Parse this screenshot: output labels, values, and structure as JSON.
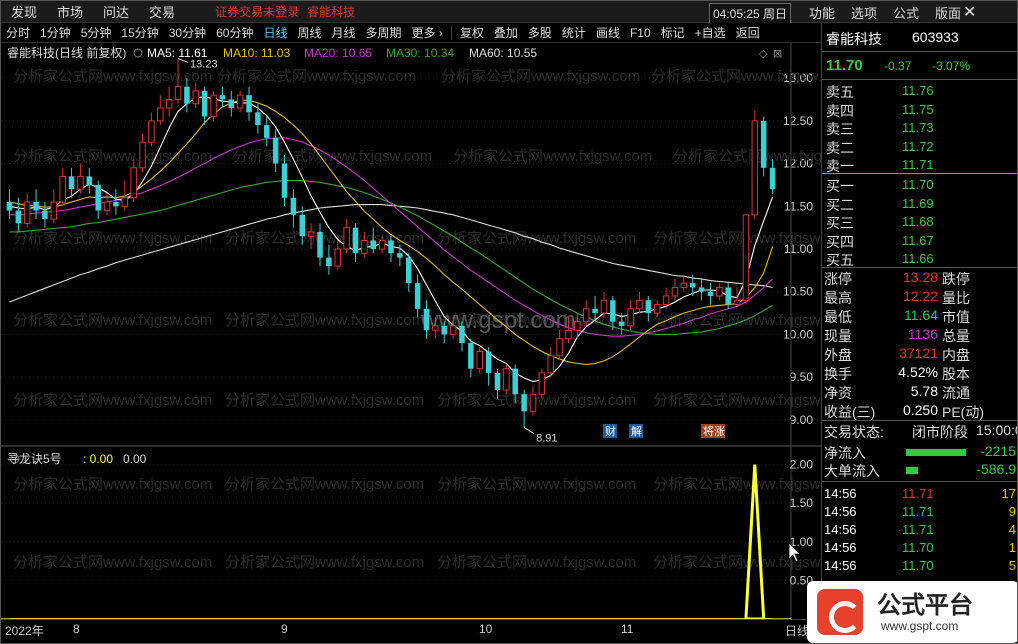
{
  "menubar": {
    "items": [
      "发现",
      "市场",
      "问达",
      "交易"
    ],
    "warning": "证券交易未登录",
    "stock_name": "睿能科技",
    "clock": "04:05:25 周日",
    "right_items": [
      "功能",
      "选项",
      "公式",
      "版面"
    ],
    "close": "✕"
  },
  "toolbar": {
    "periods": [
      "分时",
      "1分钟",
      "5分钟",
      "15分钟",
      "30分钟",
      "60分钟",
      "日线",
      "周线",
      "月线",
      "多周期",
      "更多 ›"
    ],
    "active_period": "日线",
    "actions": [
      "复权",
      "叠加",
      "多股",
      "统计",
      "画线",
      "F10",
      "标记",
      "+自选",
      "返回"
    ]
  },
  "chart_header": {
    "title": "睿能科技(日线 前复权)",
    "ma5": "MA5: 11.61",
    "ma10": "MA10: 11.03",
    "ma20": "MA20: 10.65",
    "ma30": "MA30: 10.34",
    "ma60": "MA60: 10.55"
  },
  "colors": {
    "up": "#e03030",
    "down": "#39d0d8",
    "ma5": "#ffffff",
    "ma10": "#e6c200",
    "ma20": "#cc33cc",
    "ma30": "#33aa33",
    "ma60": "#dddddd",
    "grid": "#5a0a0a",
    "indicator": "#ffff33"
  },
  "chart_data": [
    {
      "type": "candlestick",
      "title": "睿能科技(日线 前复权)",
      "yticks": [
        9.0,
        9.5,
        10.0,
        10.5,
        11.0,
        11.5,
        12.0,
        12.5,
        13.0
      ],
      "ylim": [
        8.8,
        13.2
      ],
      "high_label": "13.23",
      "low_label": "8.91",
      "annotations": [
        "财",
        "解",
        "将涨"
      ],
      "candles": [
        [
          11.55,
          11.45,
          11.7,
          11.35
        ],
        [
          11.45,
          11.3,
          11.6,
          11.2
        ],
        [
          11.3,
          11.55,
          11.65,
          11.25
        ],
        [
          11.55,
          11.45,
          11.7,
          11.35
        ],
        [
          11.45,
          11.35,
          11.55,
          11.25
        ],
        [
          11.35,
          11.55,
          11.7,
          11.3
        ],
        [
          11.55,
          11.85,
          11.95,
          11.5
        ],
        [
          11.85,
          11.7,
          11.95,
          11.6
        ],
        [
          11.7,
          11.85,
          12.0,
          11.65
        ],
        [
          11.85,
          11.75,
          11.95,
          11.65
        ],
        [
          11.75,
          11.45,
          11.8,
          11.35
        ],
        [
          11.45,
          11.55,
          11.65,
          11.4
        ],
        [
          11.55,
          11.5,
          11.7,
          11.4
        ],
        [
          11.5,
          11.6,
          11.8,
          11.45
        ],
        [
          11.6,
          11.95,
          12.05,
          11.55
        ],
        [
          11.95,
          12.25,
          12.35,
          11.9
        ],
        [
          12.25,
          12.5,
          12.6,
          12.2
        ],
        [
          12.5,
          12.65,
          12.8,
          12.45
        ],
        [
          12.65,
          12.75,
          12.9,
          12.55
        ],
        [
          12.75,
          12.9,
          13.23,
          12.7
        ],
        [
          12.9,
          12.7,
          13.0,
          12.6
        ],
        [
          12.7,
          12.85,
          12.95,
          12.65
        ],
        [
          12.85,
          12.55,
          12.9,
          12.45
        ],
        [
          12.55,
          12.8,
          12.85,
          12.5
        ],
        [
          12.8,
          12.75,
          12.9,
          12.65
        ],
        [
          12.75,
          12.65,
          12.85,
          12.55
        ],
        [
          12.65,
          12.8,
          12.85,
          12.6
        ],
        [
          12.8,
          12.6,
          12.9,
          12.5
        ],
        [
          12.6,
          12.45,
          12.7,
          12.35
        ],
        [
          12.45,
          12.3,
          12.55,
          12.2
        ],
        [
          12.3,
          12.0,
          12.4,
          11.9
        ],
        [
          12.0,
          11.6,
          12.1,
          11.5
        ],
        [
          11.6,
          11.4,
          11.7,
          11.25
        ],
        [
          11.4,
          11.15,
          11.5,
          11.05
        ],
        [
          11.15,
          11.2,
          11.3,
          11.0
        ],
        [
          11.2,
          10.9,
          11.3,
          10.8
        ],
        [
          10.9,
          10.8,
          11.05,
          10.7
        ],
        [
          10.8,
          11.0,
          11.1,
          10.75
        ],
        [
          11.0,
          11.25,
          11.35,
          10.95
        ],
        [
          11.25,
          10.95,
          11.3,
          10.85
        ],
        [
          10.95,
          11.1,
          11.2,
          10.9
        ],
        [
          11.1,
          11.0,
          11.25,
          10.95
        ],
        [
          11.0,
          11.1,
          11.15,
          10.95
        ],
        [
          11.1,
          10.95,
          11.15,
          10.85
        ],
        [
          10.95,
          10.9,
          11.05,
          10.8
        ],
        [
          10.9,
          10.6,
          10.95,
          10.5
        ],
        [
          10.6,
          10.3,
          10.7,
          10.2
        ],
        [
          10.3,
          10.05,
          10.4,
          9.95
        ],
        [
          10.05,
          10.1,
          10.2,
          9.95
        ],
        [
          10.1,
          10.0,
          10.15,
          9.9
        ],
        [
          10.0,
          10.1,
          10.2,
          9.95
        ],
        [
          10.1,
          9.9,
          10.15,
          9.8
        ],
        [
          9.9,
          9.6,
          9.95,
          9.5
        ],
        [
          9.6,
          9.8,
          9.85,
          9.55
        ],
        [
          9.8,
          9.55,
          9.85,
          9.4
        ],
        [
          9.55,
          9.35,
          9.6,
          9.25
        ],
        [
          9.35,
          9.6,
          9.65,
          9.3
        ],
        [
          9.6,
          9.3,
          9.65,
          9.2
        ],
        [
          9.3,
          9.1,
          9.35,
          8.91
        ],
        [
          9.1,
          9.3,
          9.4,
          9.05
        ],
        [
          9.3,
          9.55,
          9.6,
          9.25
        ],
        [
          9.55,
          9.75,
          9.85,
          9.5
        ],
        [
          9.75,
          9.95,
          10.05,
          9.7
        ],
        [
          9.95,
          10.05,
          10.2,
          9.9
        ],
        [
          10.05,
          10.15,
          10.25,
          9.95
        ],
        [
          10.15,
          10.3,
          10.4,
          10.1
        ],
        [
          10.3,
          10.25,
          10.45,
          10.15
        ],
        [
          10.25,
          10.4,
          10.5,
          10.2
        ],
        [
          10.4,
          10.15,
          10.45,
          10.05
        ],
        [
          10.15,
          10.1,
          10.25,
          10.0
        ],
        [
          10.1,
          10.3,
          10.4,
          10.05
        ],
        [
          10.3,
          10.4,
          10.5,
          10.25
        ],
        [
          10.4,
          10.25,
          10.45,
          10.15
        ],
        [
          10.25,
          10.35,
          10.4,
          10.2
        ],
        [
          10.35,
          10.45,
          10.55,
          10.3
        ],
        [
          10.45,
          10.55,
          10.65,
          10.4
        ],
        [
          10.55,
          10.6,
          10.7,
          10.5
        ],
        [
          10.6,
          10.55,
          10.7,
          10.45
        ],
        [
          10.55,
          10.5,
          10.65,
          10.4
        ],
        [
          10.5,
          10.45,
          10.6,
          10.35
        ],
        [
          10.45,
          10.55,
          10.6,
          10.4
        ],
        [
          10.55,
          10.35,
          10.6,
          10.3
        ],
        [
          10.35,
          10.4,
          10.55,
          10.35
        ],
        [
          10.4,
          11.4,
          11.4,
          10.35
        ],
        [
          11.4,
          12.5,
          12.62,
          11.35
        ],
        [
          12.5,
          11.95,
          12.55,
          11.85
        ],
        [
          11.95,
          11.7,
          12.05,
          11.64
        ]
      ],
      "ma5": [
        11.5,
        11.48,
        11.47,
        11.49,
        11.46,
        11.49,
        11.57,
        11.62,
        11.7,
        11.76,
        11.72,
        11.66,
        11.58,
        11.57,
        11.64,
        11.79,
        11.97,
        12.19,
        12.42,
        12.61,
        12.7,
        12.77,
        12.78,
        12.76,
        12.73,
        12.72,
        12.71,
        12.71,
        12.65,
        12.56,
        12.43,
        12.25,
        12.05,
        11.84,
        11.62,
        11.43,
        11.25,
        11.11,
        11.03,
        10.98,
        11.02,
        11.03,
        11.07,
        11.03,
        11.01,
        10.92,
        10.77,
        10.58,
        10.39,
        10.21,
        10.11,
        10.04,
        9.92,
        9.87,
        9.79,
        9.71,
        9.66,
        9.55,
        9.49,
        9.45,
        9.47,
        9.52,
        9.63,
        9.78,
        9.97,
        10.09,
        10.17,
        10.25,
        10.24,
        10.21,
        10.23,
        10.26,
        10.27,
        10.3,
        10.33,
        10.38,
        10.44,
        10.48,
        10.52,
        10.52,
        10.51,
        10.45,
        10.43,
        10.64,
        11.04,
        11.33,
        11.61
      ],
      "ma10": [
        11.55,
        11.53,
        11.51,
        11.5,
        11.49,
        11.49,
        11.52,
        11.55,
        11.58,
        11.61,
        11.6,
        11.61,
        11.6,
        11.62,
        11.67,
        11.74,
        11.82,
        11.91,
        12.01,
        12.12,
        12.23,
        12.35,
        12.48,
        12.58,
        12.66,
        12.71,
        12.74,
        12.74,
        12.71,
        12.67,
        12.61,
        12.54,
        12.45,
        12.35,
        12.23,
        12.09,
        11.95,
        11.81,
        11.67,
        11.56,
        11.44,
        11.35,
        11.25,
        11.17,
        11.1,
        11.04,
        10.97,
        10.89,
        10.8,
        10.7,
        10.61,
        10.53,
        10.44,
        10.35,
        10.26,
        10.17,
        10.09,
        10.0,
        9.93,
        9.86,
        9.8,
        9.75,
        9.71,
        9.68,
        9.66,
        9.65,
        9.66,
        9.69,
        9.74,
        9.81,
        9.89,
        9.97,
        10.05,
        10.12,
        10.16,
        10.21,
        10.25,
        10.28,
        10.31,
        10.33,
        10.34,
        10.35,
        10.36,
        10.43,
        10.55,
        10.72,
        11.03
      ],
      "ma20": [
        11.4,
        11.4,
        11.41,
        11.42,
        11.43,
        11.44,
        11.45,
        11.47,
        11.49,
        11.51,
        11.53,
        11.55,
        11.57,
        11.6,
        11.63,
        11.66,
        11.7,
        11.74,
        11.79,
        11.84,
        11.89,
        11.95,
        12.0,
        12.06,
        12.11,
        12.16,
        12.2,
        12.24,
        12.27,
        12.29,
        12.3,
        12.3,
        12.28,
        12.25,
        12.21,
        12.16,
        12.1,
        12.03,
        11.96,
        11.88,
        11.8,
        11.71,
        11.62,
        11.53,
        11.44,
        11.35,
        11.26,
        11.17,
        11.08,
        10.99,
        10.91,
        10.83,
        10.75,
        10.68,
        10.61,
        10.54,
        10.47,
        10.4,
        10.34,
        10.28,
        10.22,
        10.17,
        10.12,
        10.08,
        10.05,
        10.02,
        10.0,
        9.99,
        9.98,
        9.98,
        9.99,
        10.0,
        10.02,
        10.04,
        10.07,
        10.1,
        10.13,
        10.17,
        10.2,
        10.24,
        10.27,
        10.3,
        10.33,
        10.38,
        10.46,
        10.55,
        10.65
      ],
      "ma30": [
        11.2,
        11.2,
        11.21,
        11.22,
        11.23,
        11.24,
        11.25,
        11.26,
        11.28,
        11.3,
        11.31,
        11.33,
        11.35,
        11.37,
        11.39,
        11.41,
        11.43,
        11.45,
        11.48,
        11.51,
        11.54,
        11.57,
        11.6,
        11.63,
        11.66,
        11.69,
        11.72,
        11.74,
        11.76,
        11.78,
        11.79,
        11.8,
        11.8,
        11.8,
        11.79,
        11.78,
        11.76,
        11.74,
        11.72,
        11.69,
        11.66,
        11.62,
        11.58,
        11.54,
        11.49,
        11.44,
        11.39,
        11.33,
        11.27,
        11.21,
        11.15,
        11.08,
        11.01,
        10.95,
        10.88,
        10.81,
        10.74,
        10.67,
        10.6,
        10.53,
        10.47,
        10.41,
        10.35,
        10.3,
        10.25,
        10.2,
        10.16,
        10.12,
        10.09,
        10.06,
        10.04,
        10.02,
        10.01,
        10.0,
        10.0,
        10.0,
        10.01,
        10.02,
        10.03,
        10.05,
        10.07,
        10.1,
        10.13,
        10.17,
        10.22,
        10.28,
        10.34
      ],
      "ma60": [
        10.38,
        10.42,
        10.46,
        10.5,
        10.54,
        10.58,
        10.62,
        10.66,
        10.7,
        10.73,
        10.77,
        10.8,
        10.84,
        10.87,
        10.9,
        10.93,
        10.96,
        10.99,
        11.02,
        11.05,
        11.08,
        11.11,
        11.14,
        11.17,
        11.2,
        11.23,
        11.26,
        11.29,
        11.32,
        11.35,
        11.37,
        11.4,
        11.42,
        11.44,
        11.46,
        11.48,
        11.49,
        11.5,
        11.51,
        11.52,
        11.52,
        11.52,
        11.52,
        11.51,
        11.5,
        11.49,
        11.48,
        11.46,
        11.44,
        11.42,
        11.4,
        11.37,
        11.34,
        11.31,
        11.28,
        11.25,
        11.22,
        11.19,
        11.15,
        11.12,
        11.08,
        11.05,
        11.01,
        10.98,
        10.95,
        10.92,
        10.89,
        10.86,
        10.83,
        10.81,
        10.79,
        10.77,
        10.75,
        10.73,
        10.71,
        10.69,
        10.68,
        10.66,
        10.65,
        10.63,
        10.62,
        10.61,
        10.6,
        10.59,
        10.58,
        10.57,
        10.55
      ]
    },
    {
      "type": "line",
      "title": "寻龙诀5号",
      "value_label": ": 0.00",
      "value_label2": "0.00",
      "yticks": [
        0.5,
        1.0,
        1.5,
        2.0
      ],
      "ylim": [
        0,
        2.15
      ],
      "values": [
        0,
        0,
        0,
        0,
        0,
        0,
        0,
        0,
        0,
        0,
        0,
        0,
        0,
        0,
        0,
        0,
        0,
        0,
        0,
        0,
        0,
        0,
        0,
        0,
        0,
        0,
        0,
        0,
        0,
        0,
        0,
        0,
        0,
        0,
        0,
        0,
        0,
        0,
        0,
        0,
        0,
        0,
        0,
        0,
        0,
        0,
        0,
        0,
        0,
        0,
        0,
        0,
        0,
        0,
        0,
        0,
        0,
        0,
        0,
        0,
        0,
        0,
        0,
        0,
        0,
        0,
        0,
        0,
        0,
        0,
        0,
        0,
        0,
        0,
        0,
        0,
        0,
        0,
        0,
        0,
        0,
        0,
        0,
        0,
        2,
        0,
        0
      ]
    }
  ],
  "dates": {
    "year": "2022年",
    "months": [
      "8",
      "9",
      "10",
      "11"
    ],
    "period_label": "日线"
  },
  "quote": {
    "name": "睿能科技",
    "code": "603933",
    "price": "11.70",
    "change": "-0.37",
    "pct": "-3.07%"
  },
  "order_book": {
    "sell": [
      {
        "label": "卖五",
        "price": "11.76"
      },
      {
        "label": "卖四",
        "price": "11.75"
      },
      {
        "label": "卖三",
        "price": "11.73"
      },
      {
        "label": "卖二",
        "price": "11.72"
      },
      {
        "label": "卖一",
        "price": "11.71"
      }
    ],
    "buy": [
      {
        "label": "买一",
        "price": "11.70"
      },
      {
        "label": "买二",
        "price": "11.69"
      },
      {
        "label": "买三",
        "price": "11.68"
      },
      {
        "label": "买四",
        "price": "11.67"
      },
      {
        "label": "买五",
        "price": "11.66"
      }
    ]
  },
  "stats": [
    {
      "l1": "涨停",
      "v1": "13.28",
      "l2": "跌停",
      "c": "#e03030"
    },
    {
      "l1": "最高",
      "v1": "12.22",
      "l2": "量比",
      "c": "#e03030"
    },
    {
      "l1": "最低",
      "v1": "11.64",
      "l2": "市值",
      "c": "#2ecc40"
    },
    {
      "l1": "现量",
      "v1": "1136",
      "l2": "总量",
      "c": "#cc33cc"
    },
    {
      "l1": "外盘",
      "v1": "37121",
      "l2": "内盘",
      "c": "#e03030"
    },
    {
      "l1": "换手",
      "v1": "4.52%",
      "l2": "股本",
      "c": "#ffffff"
    },
    {
      "l1": "净资",
      "v1": "5.78",
      "l2": "流通",
      "c": "#ffffff"
    },
    {
      "l1": "收益(三)",
      "v1": "0.250",
      "l2": "PE(动)",
      "c": "#ffffff"
    }
  ],
  "status": {
    "label": "交易状态:",
    "value": "闭市阶段",
    "time": "15:00:0"
  },
  "flows": [
    {
      "label": "净流入",
      "value": "-2215"
    },
    {
      "label": "大单流入",
      "value": "-586.9"
    }
  ],
  "trades": [
    {
      "t": "14:56",
      "p": "11.71",
      "v": "17",
      "pc": "#e03030",
      "vc": "#e6c200"
    },
    {
      "t": "14:56",
      "p": "11.71",
      "v": "9",
      "pc": "#2ecc40",
      "vc": "#e6c200"
    },
    {
      "t": "14:56",
      "p": "11.71",
      "v": "4",
      "pc": "#2ecc40",
      "vc": "#e6c200"
    },
    {
      "t": "14:56",
      "p": "11.70",
      "v": "1",
      "pc": "#2ecc40",
      "vc": "#e6c200"
    },
    {
      "t": "14:56",
      "p": "11.70",
      "v": "5",
      "pc": "#2ecc40",
      "vc": "#e6c200"
    }
  ],
  "logo": {
    "title": "公式平台",
    "url": "www.gspt.com"
  },
  "watermarks": {
    "main": "www.gspt.com",
    "tile": "分析家公式网www.fxjgsw.com"
  }
}
